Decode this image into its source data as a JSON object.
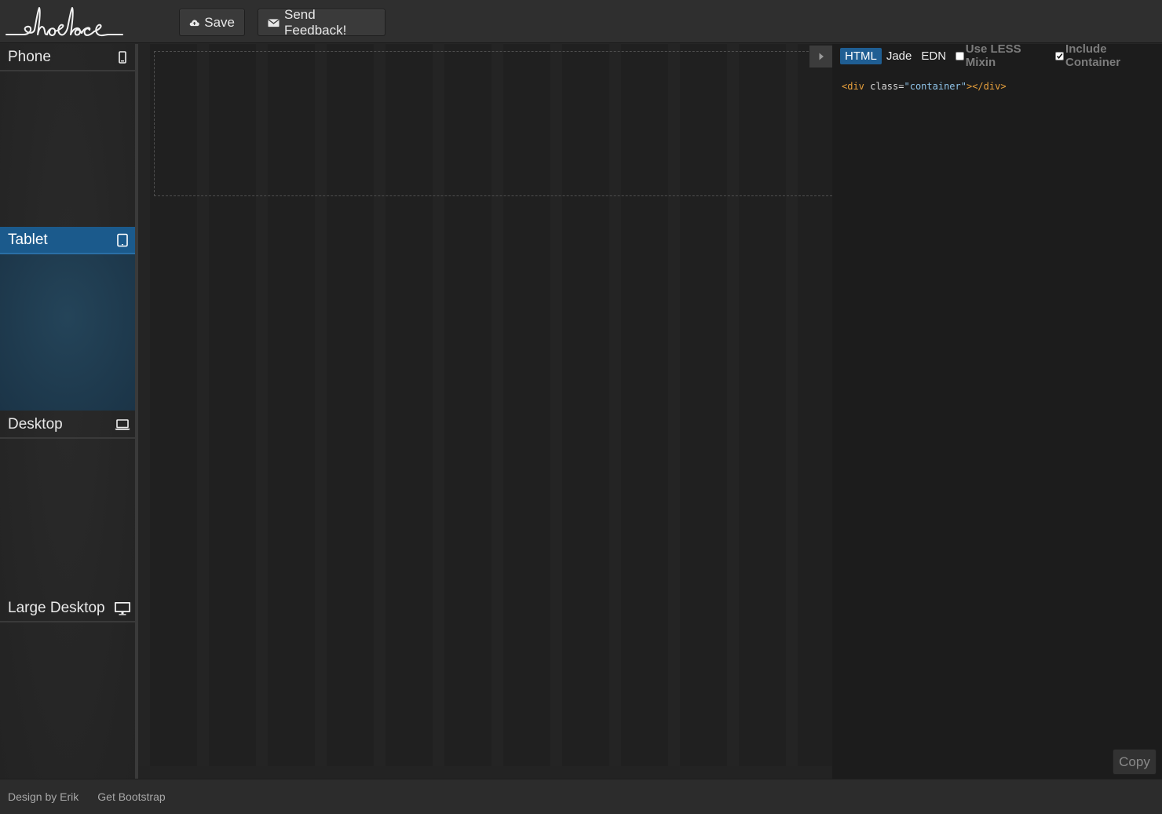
{
  "header": {
    "logo_text": "shoelace",
    "save_label": "Save",
    "feedback_label": "Send Feedback!"
  },
  "sidebar": {
    "devices": [
      {
        "label": "Phone",
        "icon": "phone-icon",
        "active": false
      },
      {
        "label": "Tablet",
        "icon": "tablet-icon",
        "active": true
      },
      {
        "label": "Desktop",
        "icon": "laptop-icon",
        "active": false
      },
      {
        "label": "Large Desktop",
        "icon": "monitor-icon",
        "active": false
      }
    ]
  },
  "code_panel": {
    "tabs": [
      {
        "label": "HTML",
        "active": true
      },
      {
        "label": "Jade",
        "active": false
      },
      {
        "label": "EDN",
        "active": false
      }
    ],
    "options": [
      {
        "label": "Use LESS Mixin",
        "checked": false
      },
      {
        "label": "Include Container",
        "checked": true
      }
    ],
    "code": {
      "open_tag": "<div",
      "attr_name": " class",
      "equals": "=",
      "attr_value": "\"container\"",
      "close_tag": "></div>"
    },
    "copy_label": "Copy"
  },
  "footer": {
    "links": [
      "Design by Erik",
      "Get Bootstrap"
    ]
  },
  "colors": {
    "accent": "#1f5e93",
    "background": "#262626",
    "code_tag": "#e8a03c",
    "code_string": "#8fc3e8"
  }
}
